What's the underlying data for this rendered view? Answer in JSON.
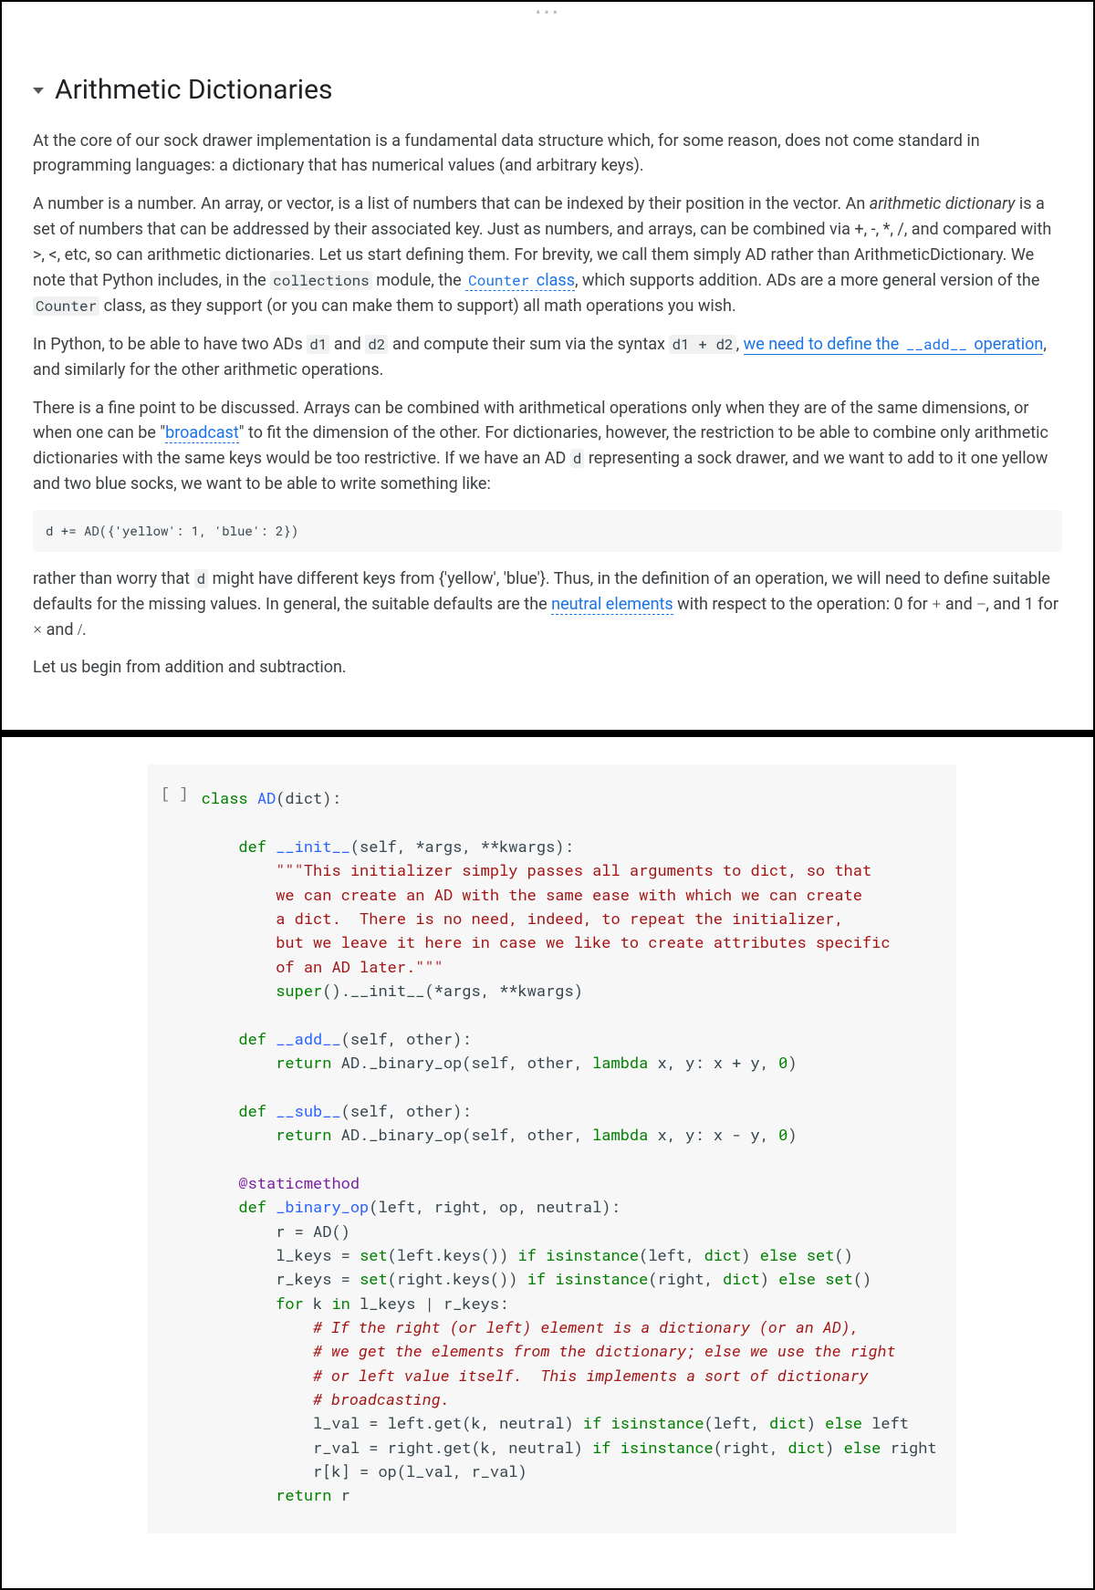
{
  "heading": "Arithmetic Dictionaries",
  "p1": "At the core of our sock drawer implementation is a fundamental data structure which, for some reason, does not come standard in programming languages: a dictionary that has numerical values (and arbitrary keys).",
  "p2_a": "A number is a number. An array, or vector, is a list of numbers that can be indexed by their position in the vector. An ",
  "p2_em": "arithmetic dictionary",
  "p2_b": " is a set of numbers that can be addressed by their associated key. Just as numbers, and arrays, can be combined via +, -, *, /, and compared with >, <, etc, so can arithmetic dictionaries. Let us start defining them. For brevity, we call them simply AD rather than ArithmeticDictionary. We note that Python includes, in the ",
  "p2_c_collections": "collections",
  "p2_d": " module, the ",
  "p2_link_counter": "Counter",
  "p2_link_class": " class",
  "p2_e": ", which supports addition. ADs are a more general version of the ",
  "p2_f_counter2": "Counter",
  "p2_g": " class, as they support (or you can make them to support) all math operations you wish.",
  "p3_a": "In Python, to be able to have two ADs ",
  "p3_d1": "d1",
  "p3_b": " and ",
  "p3_d2": "d2",
  "p3_c": " and compute their sum via the syntax ",
  "p3_expr": "d1 + d2",
  "p3_d": ", ",
  "p3_link1": "we need to define the ",
  "p3_add": "__add__",
  "p3_link2": " operation",
  "p3_e": ", and similarly for the other arithmetic operations.",
  "p4_a": "There is a fine point to be discussed. Arrays can be combined with arithmetical operations only when they are of the same dimensions, or when one can be \"",
  "p4_link_broadcast": "broadcast",
  "p4_b": "\" to fit the dimension of the other. For dictionaries, however, the restriction to be able to combine only arithmetic dictionaries with the same keys would be too restrictive. If we have an AD ",
  "p4_d": "d",
  "p4_c": " representing a sock drawer, and we want to add to it one yellow and two blue socks, we want to be able to write something like:",
  "code_small": "d += AD({'yellow': 1, 'blue': 2})",
  "p5_a": "rather than worry that ",
  "p5_d": "d",
  "p5_b": " might have different keys from {'yellow', 'blue'}. Thus, in the definition of an operation, we will need to define suitable defaults for the missing values. In general, the suitable defaults are the ",
  "p5_link_neutral": "neutral elements",
  "p5_c": " with respect to the operation: 0 for ",
  "p5_plus": "+",
  "p5_and1": " and ",
  "p5_minus": "−",
  "p5_comma": ", and 1 for ",
  "p5_times": "×",
  "p5_and2": " and ",
  "p5_div": "/",
  "p5_dot": ".",
  "p6": "Let us begin from addition and subtraction.",
  "cell": {
    "prompt": "[ ]",
    "l01_kw_class": "class",
    "l01_cls": "AD",
    "l01_rest": "(dict):",
    "l03_kw_def": "def",
    "l03_nm": "__init__",
    "l03_sig": "(self, *args, **kwargs):",
    "doc1": "\"\"\"This initializer simply passes all arguments to dict, so that",
    "doc2": "we can create an AD with the same ease with which we can create",
    "doc3": "a dict.  There is no need, indeed, to repeat the initializer,",
    "doc4": "but we leave it here in case we like to create attributes specific",
    "doc5": "of an AD later.\"\"\"",
    "l09_super": "super",
    "l09_rest": "().__init__(*args, **kwargs)",
    "l11_kw_def": "def",
    "l11_nm": "__add__",
    "l11_sig": "(self, other):",
    "l12_kw_return": "return",
    "l12_body_a": " AD._binary_op(self, other, ",
    "l12_lambda": "lambda",
    "l12_body_b": " x, y: x + y, ",
    "l12_zero": "0",
    "l12_body_c": ")",
    "l14_kw_def": "def",
    "l14_nm": "__sub__",
    "l14_sig": "(self, other):",
    "l15_kw_return": "return",
    "l15_body_a": " AD._binary_op(self, other, ",
    "l15_lambda": "lambda",
    "l15_body_b": " x, y: x - y, ",
    "l15_zero": "0",
    "l15_body_c": ")",
    "deco": "@staticmethod",
    "l18_kw_def": "def",
    "l18_nm": "_binary_op",
    "l18_sig": "(left, right, op, neutral):",
    "l19": "r = AD()",
    "l20_a": "l_keys = ",
    "l20_set": "set",
    "l20_b": "(left.keys()) ",
    "l20_if": "if",
    "l20_c": " ",
    "l20_isinstance": "isinstance",
    "l20_d": "(left, ",
    "l20_dict": "dict",
    "l20_e": ") ",
    "l20_else": "else",
    "l20_f": " ",
    "l20_set2": "set",
    "l20_g": "()",
    "l21_a": "r_keys = ",
    "l21_set": "set",
    "l21_b": "(right.keys()) ",
    "l21_if": "if",
    "l21_c": " ",
    "l21_isinstance": "isinstance",
    "l21_d": "(right, ",
    "l21_dict": "dict",
    "l21_e": ") ",
    "l21_else": "else",
    "l21_f": " ",
    "l21_set2": "set",
    "l21_g": "()",
    "l22_for": "for",
    "l22_a": " k ",
    "l22_in": "in",
    "l22_b": " l_keys | r_keys:",
    "cmt1": "# If the right (or left) element is a dictionary (or an AD),",
    "cmt2": "# we get the elements from the dictionary; else we use the right",
    "cmt3": "# or left value itself.  This implements a sort of dictionary",
    "cmt4": "# broadcasting.",
    "l27_a": "l_val = left.get(k, neutral) ",
    "l27_if": "if",
    "l27_b": " ",
    "l27_isinstance": "isinstance",
    "l27_c": "(left, ",
    "l27_dict": "dict",
    "l27_d": ") ",
    "l27_else": "else",
    "l27_e": " left",
    "l28_a": "r_val = right.get(k, neutral) ",
    "l28_if": "if",
    "l28_b": " ",
    "l28_isinstance": "isinstance",
    "l28_c": "(right, ",
    "l28_dict": "dict",
    "l28_d": ") ",
    "l28_else": "else",
    "l28_e": " right",
    "l29": "r[k] = op(l_val, r_val)",
    "l30_return": "return",
    "l30_r": " r"
  }
}
